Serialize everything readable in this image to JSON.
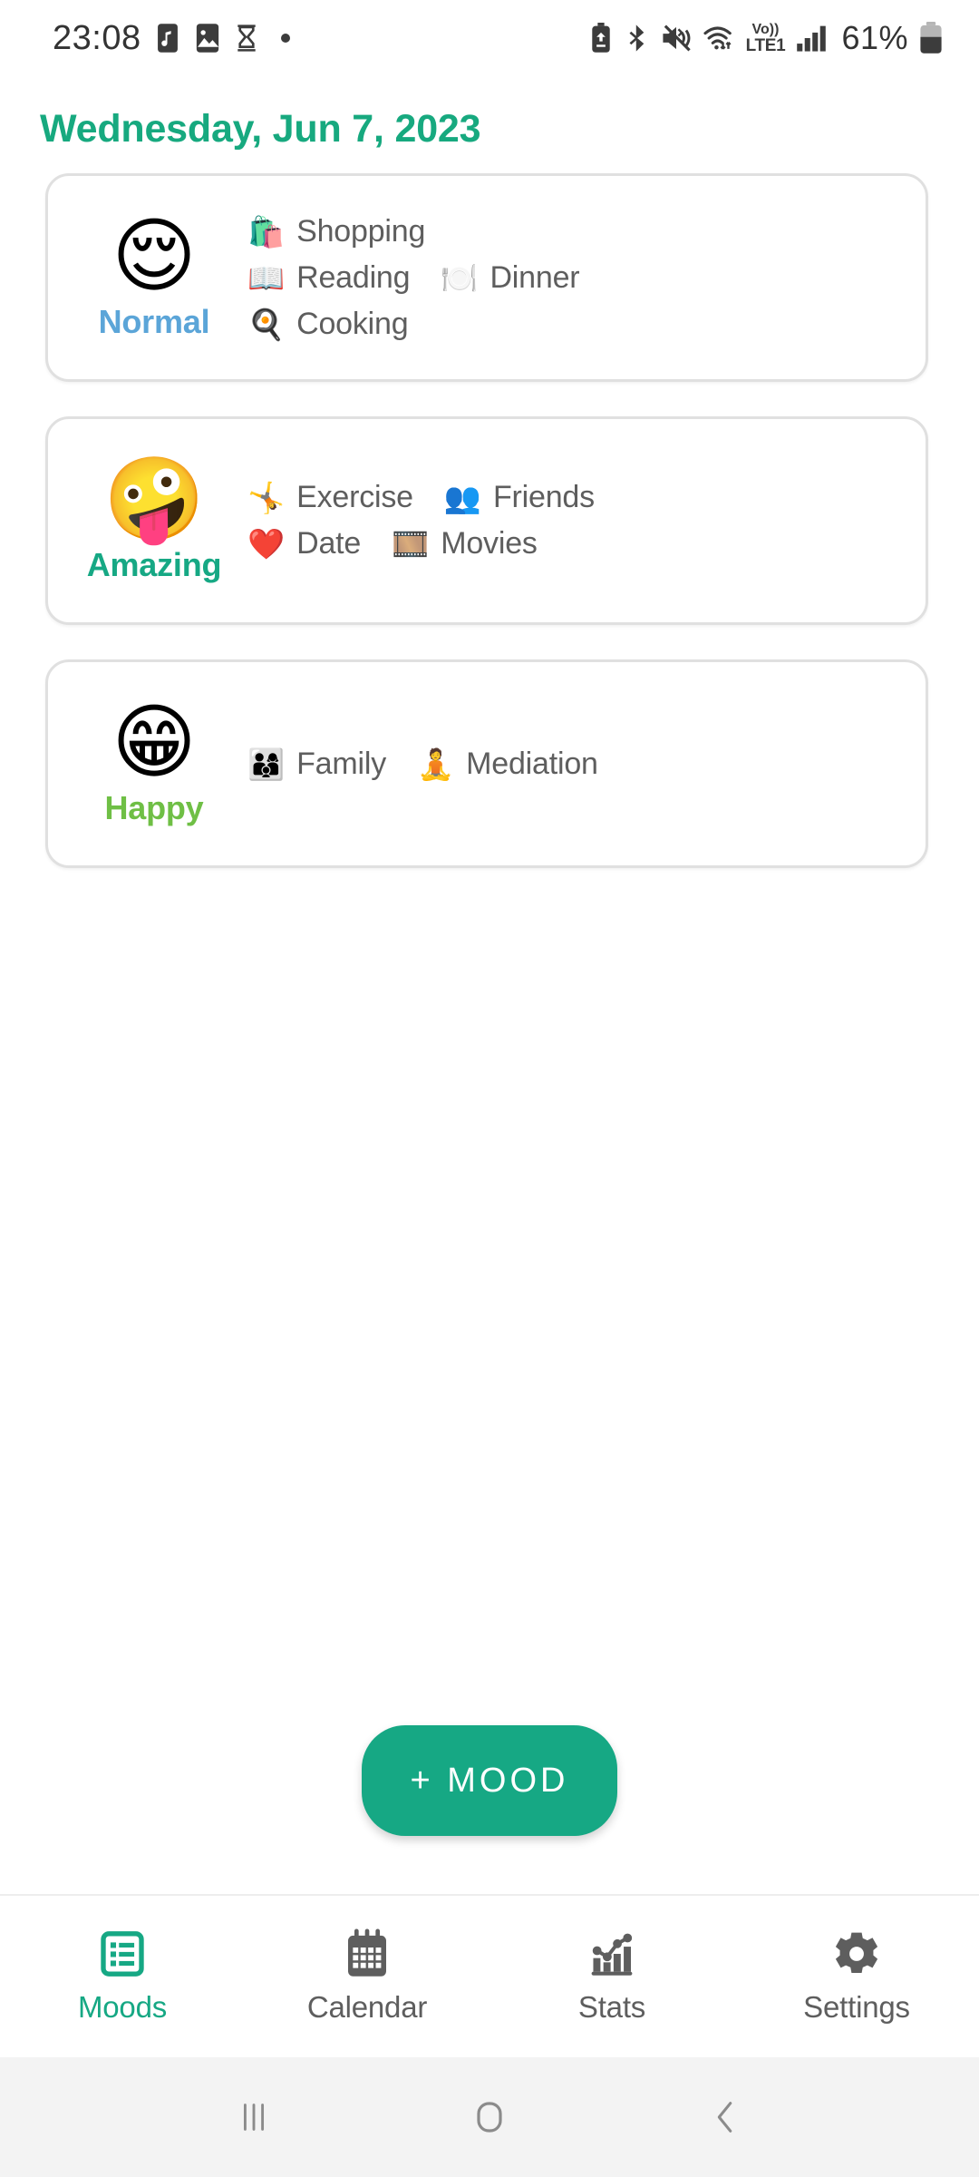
{
  "status_bar": {
    "time": "23:08",
    "battery_percent": "61%",
    "volte_top": "Vo))",
    "volte_bottom": "LTE1",
    "left_icons": [
      "music-note-icon",
      "gallery-image-icon",
      "hourglass-icon",
      "dot-indicator-icon"
    ],
    "right_icons": [
      "battery-saver-icon",
      "bluetooth-icon",
      "mute-vibrate-icon",
      "wifi-data-icon",
      "volte-icon",
      "signal-bars-icon",
      "battery-icon"
    ]
  },
  "header": {
    "date": "Wednesday, Jun 7, 2023",
    "date_color": "#17a97f"
  },
  "moods": [
    {
      "emoji": "😌",
      "emoji_name": "relieved-face-emoji",
      "label": "Normal",
      "color": "#5ba5d8",
      "rows": [
        [
          {
            "emoji": "🛍️",
            "emoji_name": "shopping-bags-emoji",
            "label": "Shopping"
          }
        ],
        [
          {
            "emoji": "📖",
            "emoji_name": "open-book-emoji",
            "label": "Reading"
          },
          {
            "emoji": "🍽️",
            "emoji_name": "fork-knife-plate-emoji",
            "label": "Dinner"
          }
        ],
        [
          {
            "emoji": "🍳",
            "emoji_name": "frying-pan-emoji",
            "label": "Cooking"
          }
        ]
      ]
    },
    {
      "emoji": "🤪",
      "emoji_name": "zany-face-emoji",
      "label": "Amazing",
      "color": "#16a884",
      "rows": [
        [
          {
            "emoji": "🤸",
            "emoji_name": "cartwheeling-person-emoji",
            "label": "Exercise"
          },
          {
            "emoji": "👥",
            "emoji_name": "busts-in-silhouette-emoji",
            "label": "Friends"
          }
        ],
        [
          {
            "emoji": "❤️",
            "emoji_name": "red-heart-emoji",
            "label": "Date"
          },
          {
            "emoji": "🎞️",
            "emoji_name": "film-frames-emoji",
            "label": "Movies"
          }
        ]
      ]
    },
    {
      "emoji": "😁",
      "emoji_name": "beaming-face-emoji",
      "label": "Happy",
      "color": "#6fbf45",
      "rows": [
        [
          {
            "emoji": "👨‍👩‍👦",
            "emoji_name": "family-emoji",
            "label": "Family"
          },
          {
            "emoji": "🧘",
            "emoji_name": "person-lotus-position-emoji",
            "label": "Mediation"
          }
        ]
      ]
    }
  ],
  "fab": {
    "label": "+ MOOD",
    "color": "#16a884"
  },
  "bottom_nav": {
    "active_color": "#16a884",
    "inactive_color": "#5e5e5e",
    "items": [
      {
        "label": "Moods",
        "icon": "list-box-icon",
        "active": true
      },
      {
        "label": "Calendar",
        "icon": "calendar-icon",
        "active": false
      },
      {
        "label": "Stats",
        "icon": "bar-chart-icon",
        "active": false
      },
      {
        "label": "Settings",
        "icon": "gear-icon",
        "active": false
      }
    ]
  },
  "android_nav": {
    "recents": "recents-icon",
    "home": "home-icon",
    "back": "back-icon"
  }
}
